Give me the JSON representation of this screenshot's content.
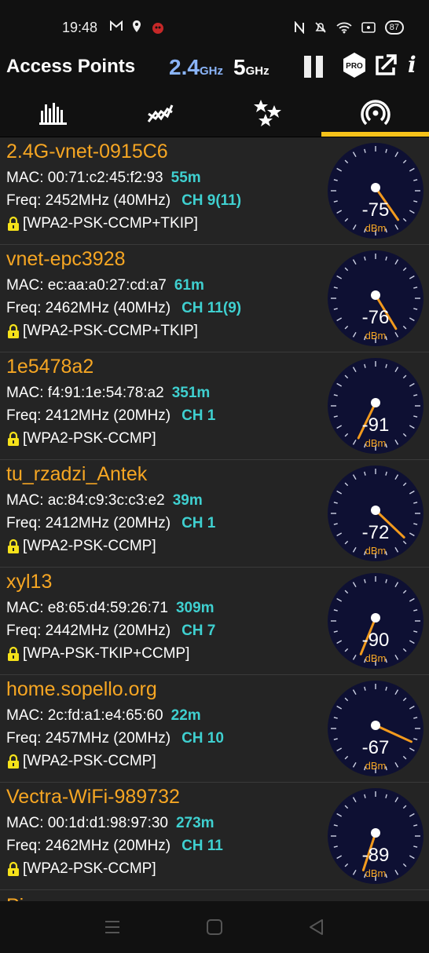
{
  "status_bar": {
    "time": "19:48",
    "battery": "87",
    "left_icons": [
      "gmail-icon",
      "location-icon",
      "app-notification-icon"
    ],
    "right_icons": [
      "nfc-icon",
      "mute-bell-icon",
      "wifi-icon",
      "screencast-icon",
      "battery-icon"
    ]
  },
  "app_bar": {
    "title": "Access Points",
    "band_24": "2.4",
    "band_24_unit": "GHz",
    "band_5": "5",
    "band_5_unit": "GHz",
    "pro_label": "PRO",
    "info_label": "i"
  },
  "tabs": [
    {
      "name": "channel-graph",
      "icon": "bar-chart-icon"
    },
    {
      "name": "time-graph",
      "icon": "line-graph-icon"
    },
    {
      "name": "channel-rating",
      "icon": "stars-icon"
    },
    {
      "name": "access-points",
      "icon": "wifi-radar-icon",
      "active": true
    }
  ],
  "access_points": [
    {
      "ssid": "2.4G-vnet-0915C6",
      "mac": "MAC: 00:71:c2:45:f2:93",
      "distance": "55m",
      "freq": "Freq: 2452MHz  (40MHz)",
      "channel": "CH 9(11)",
      "security": "[WPA2-PSK-CCMP+TKIP]",
      "dbm": -75
    },
    {
      "ssid": "vnet-epc3928",
      "mac": "MAC: ec:aa:a0:27:cd:a7",
      "distance": "61m",
      "freq": "Freq: 2462MHz  (40MHz)",
      "channel": "CH 11(9)",
      "security": "[WPA2-PSK-CCMP+TKIP]",
      "dbm": -76
    },
    {
      "ssid": "1e5478a2",
      "mac": "MAC: f4:91:1e:54:78:a2",
      "distance": "351m",
      "freq": "Freq: 2412MHz  (20MHz)",
      "channel": "CH 1",
      "security": "[WPA2-PSK-CCMP]",
      "dbm": -91
    },
    {
      "ssid": "tu_rzadzi_Antek",
      "mac": "MAC: ac:84:c9:3c:c3:e2",
      "distance": "39m",
      "freq": "Freq: 2412MHz  (20MHz)",
      "channel": "CH 1",
      "security": "[WPA2-PSK-CCMP]",
      "dbm": -72
    },
    {
      "ssid": "xyl13",
      "mac": "MAC: e8:65:d4:59:26:71",
      "distance": "309m",
      "freq": "Freq: 2442MHz  (20MHz)",
      "channel": "CH 7",
      "security": "[WPA-PSK-TKIP+CCMP]",
      "dbm": -90
    },
    {
      "ssid": "home.sopello.org",
      "mac": "MAC: 2c:fd:a1:e4:65:60",
      "distance": "22m",
      "freq": "Freq: 2457MHz  (20MHz)",
      "channel": "CH 10",
      "security": "[WPA2-PSK-CCMP]",
      "dbm": -67
    },
    {
      "ssid": "Vectra-WiFi-989732",
      "mac": "MAC: 00:1d:d1:98:97:30",
      "distance": "273m",
      "freq": "Freq: 2462MHz  (20MHz)",
      "channel": "CH 11",
      "security": "[WPA2-PSK-CCMP]",
      "dbm": -89
    }
  ],
  "partial_item": {
    "ssid": "Pi"
  },
  "gauge_unit": "dBm",
  "colors": {
    "ssid": "#f6a623",
    "accent": "#3fd0d0",
    "gauge_face": "#0e1033",
    "needle": "#f29a1d",
    "tab_underline": "#f6c21a",
    "lock": "#f6e21a"
  },
  "nav_bar": {
    "icons": [
      "menu-icon",
      "home-icon",
      "back-icon"
    ]
  }
}
